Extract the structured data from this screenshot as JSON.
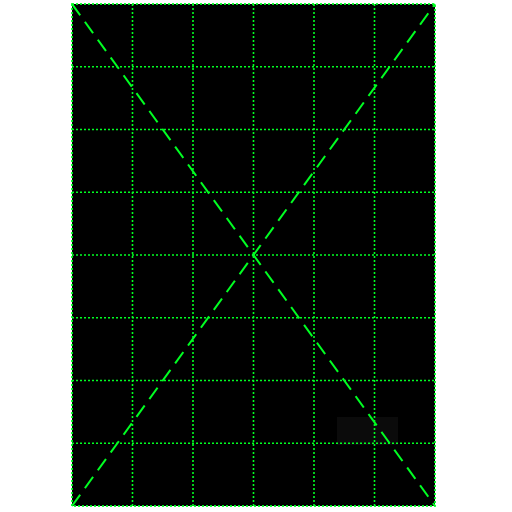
{
  "canvas": {
    "outer_background": "#ffffff",
    "panel_background": "#000000",
    "grid_color": "#00ff22",
    "diagonal_color": "#00ff22",
    "overlay_block_color": "#0b0b0b"
  },
  "grid": {
    "columns": 6,
    "rows": 8,
    "line_style": "dotted",
    "border_style": "dotted"
  },
  "diagonals": {
    "line_style": "dashed",
    "count": 2
  }
}
